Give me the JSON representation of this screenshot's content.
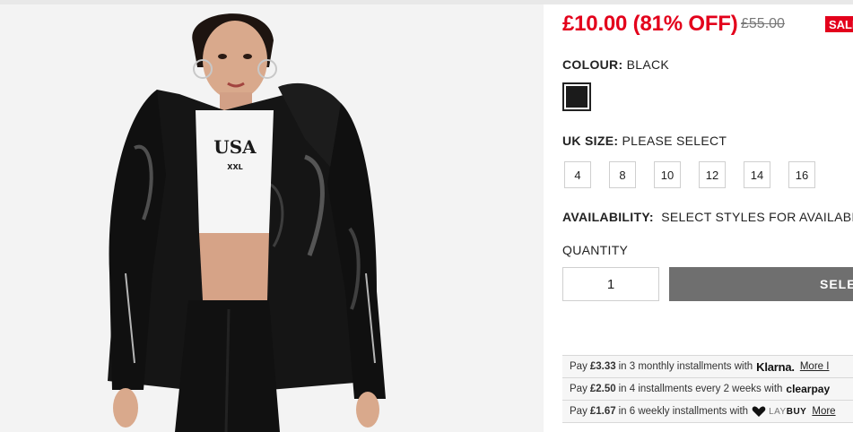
{
  "product": {
    "price": "£10.00 (81% OFF)",
    "was_price": "£55.00",
    "sale_badge": "SALE"
  },
  "colour": {
    "label": "COLOUR:",
    "value": "BLACK",
    "swatch_color": "#1b1b1b"
  },
  "size": {
    "label": "UK SIZE:",
    "value": "PLEASE SELECT",
    "options": [
      "4",
      "8",
      "10",
      "12",
      "14",
      "16"
    ]
  },
  "availability": {
    "label": "AVAILABILITY:",
    "value": "SELECT STYLES FOR AVAILABILITY"
  },
  "quantity": {
    "label": "QUANTITY",
    "value": "1"
  },
  "add_button": {
    "label": "SELECT"
  },
  "payments": [
    {
      "prefix": "Pay",
      "amount": "£3.33",
      "text": "in 3 monthly installments with",
      "brand": "Klarna.",
      "more": "More I"
    },
    {
      "prefix": "Pay",
      "amount": "£2.50",
      "text": "in 4 installments every 2 weeks with",
      "brand": "clearpay",
      "more": ""
    },
    {
      "prefix": "Pay",
      "amount": "£1.67",
      "text": "in 6 weekly installments with",
      "brand_a": "LAY",
      "brand_b": "BUY",
      "more": "More"
    }
  ],
  "photo": {
    "tee_text": "USA",
    "tee_subtext": "XXL",
    "colors": {
      "background": "#f3f3f3",
      "jacket": "#151515",
      "tee": "#f5f5f5",
      "skin": "#d9a98c",
      "leggings": "#111111"
    }
  },
  "colors": {
    "accent_red": "#e3001b",
    "button_grey": "#6f6f6f"
  }
}
